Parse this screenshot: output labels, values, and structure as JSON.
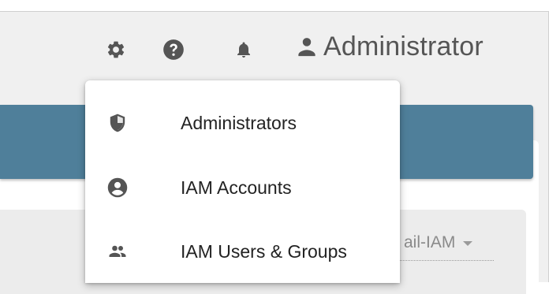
{
  "header": {
    "user_name": "Administrator",
    "icons": [
      "gear-icon",
      "help-icon",
      "bell-icon",
      "person-icon"
    ]
  },
  "menu": {
    "items": [
      {
        "label": "Administrators",
        "icon": "shield-icon"
      },
      {
        "label": "IAM Accounts",
        "icon": "account-circle-icon"
      },
      {
        "label": "IAM Users & Groups",
        "icon": "people-icon"
      }
    ]
  },
  "filter": {
    "account_value": "ail-IAM"
  },
  "colors": {
    "accent_bar": "#4f7f9a",
    "icon_gray": "#555555",
    "text_dark": "#222222"
  }
}
